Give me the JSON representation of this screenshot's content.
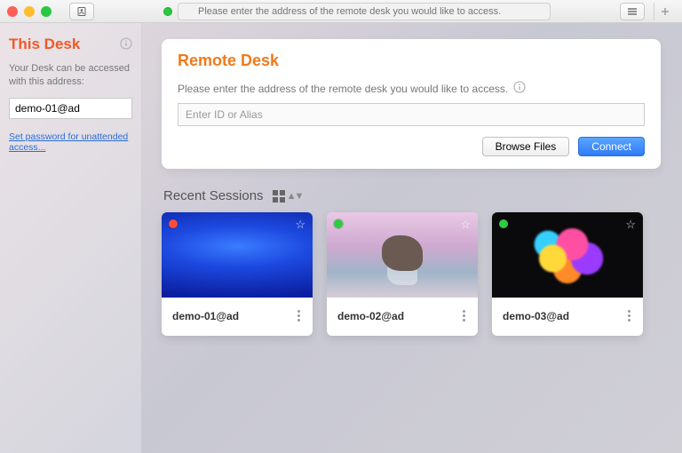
{
  "titlebar": {
    "search_placeholder": "Please enter the address of the remote desk you would like to access."
  },
  "sidebar": {
    "title": "This Desk",
    "description": "Your Desk can be accessed with this address:",
    "address_value": "demo-01@ad",
    "link_label": "Set password for unattended access..."
  },
  "remote": {
    "title": "Remote Desk",
    "description": "Please enter the address of the remote desk you would like to access.",
    "input_placeholder": "Enter ID or Alias",
    "browse_label": "Browse Files",
    "connect_label": "Connect"
  },
  "recent": {
    "heading": "Recent Sessions",
    "sessions": [
      {
        "label": "demo-01@ad",
        "status": "offline"
      },
      {
        "label": "demo-02@ad",
        "status": "online"
      },
      {
        "label": "demo-03@ad",
        "status": "online"
      }
    ]
  }
}
